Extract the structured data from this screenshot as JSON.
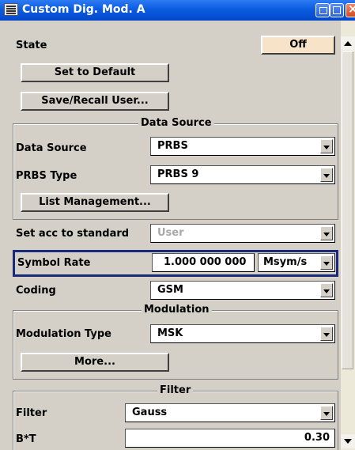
{
  "window": {
    "title": "Custom Dig. Mod. A"
  },
  "state": {
    "label": "State",
    "value": "Off"
  },
  "buttons": {
    "set_default": "Set to Default",
    "save_recall": "Save/Recall User...",
    "list_mgmt": "List Management...",
    "more": "More..."
  },
  "data_source_group": {
    "title": "Data Source",
    "data_source": {
      "label": "Data Source",
      "value": "PRBS"
    },
    "prbs_type": {
      "label": "PRBS Type",
      "value": "PRBS 9"
    }
  },
  "set_acc": {
    "label": "Set acc to standard",
    "value": "User"
  },
  "symbol_rate": {
    "label": "Symbol Rate",
    "value": "1.000 000 000",
    "unit": "Msym/s"
  },
  "coding": {
    "label": "Coding",
    "value": "GSM"
  },
  "modulation_group": {
    "title": "Modulation",
    "type": {
      "label": "Modulation Type",
      "value": "MSK"
    }
  },
  "filter_group": {
    "title": "Filter",
    "filter": {
      "label": "Filter",
      "value": "Gauss"
    },
    "bt": {
      "label": "B*T",
      "value": "0.30"
    }
  },
  "colors": {
    "titlebar": "#0a5ce0",
    "highlight_border": "#1a2a7a",
    "state_button": "#f7e4c8",
    "face": "#d4d0c8"
  }
}
